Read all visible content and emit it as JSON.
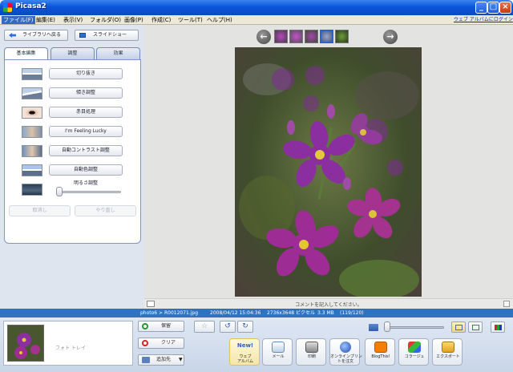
{
  "window": {
    "title": "Picasa2"
  },
  "menu": {
    "items": [
      "ファイル(F)",
      "編集(E)",
      "表示(V)",
      "フォルダ(O)",
      "画像(P)",
      "作成(C)",
      "ツール(T)",
      "ヘルプ(H)"
    ],
    "web_link": "ウェブ アルバムにログイン"
  },
  "toolbar": {
    "back_label": "ライブラリへ戻る",
    "slideshow_label": "スライドショー"
  },
  "edit_tabs": [
    "基本編集",
    "調整",
    "効果"
  ],
  "tools": [
    {
      "label": "切り抜き",
      "thumb": "mountain-landscape"
    },
    {
      "label": "傾き調整",
      "thumb": "mountain-landscape"
    },
    {
      "label": "赤目処理",
      "thumb": "eye"
    },
    {
      "label": "I'm Feeling Lucky",
      "thumb": "person-photo"
    },
    {
      "label": "自動コントラスト調整",
      "thumb": "person-photo"
    },
    {
      "label": "自動色調整",
      "thumb": "mountain-landscape"
    }
  ],
  "fill_light": {
    "label": "明るさ調整",
    "value": 0
  },
  "undo_label": "取消し",
  "redo_label": "やり直し",
  "caption_placeholder": "コメントを記入してください。",
  "status": {
    "path": "photo6 > R0012071.jpg",
    "datetime": "2008/04/12 15:04:36",
    "dimensions": "2736x3648 ピクセル",
    "size": "3.3 MB",
    "position": "(119/120)"
  },
  "tray": {
    "label": "フォト トレイ",
    "hold_label": "保留",
    "clear_label": "クリア",
    "add_label": "追加先"
  },
  "actions": [
    {
      "id": "web",
      "label": "ウェブ\nアルバム",
      "badge": "New!"
    },
    {
      "id": "mail",
      "label": "メール"
    },
    {
      "id": "print",
      "label": "印刷"
    },
    {
      "id": "order",
      "label": "オンラインプリン\nトを注文"
    },
    {
      "id": "blog",
      "label": "BlogThis!"
    },
    {
      "id": "collage",
      "label": "コラージュ"
    },
    {
      "id": "export",
      "label": "エクスポート"
    }
  ],
  "zoom_level": 0.08,
  "colors": {
    "title_bar": "#0b52d6",
    "status_bar": "#2f72bd",
    "accent": "#316ac5"
  }
}
